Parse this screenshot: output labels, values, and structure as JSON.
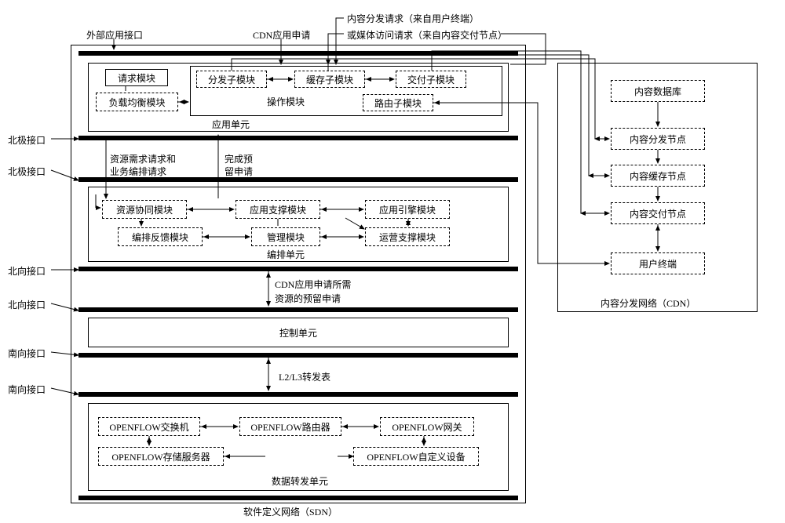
{
  "top_labels": {
    "external_interface": "外部应用接口",
    "cdn_app_request": "CDN应用申请",
    "content_dist_req": "内容分发请求（来自用户终端）",
    "media_access_req": "或媒体访问请求（来自内容交付节点）"
  },
  "side_labels": {
    "north_pole_1": "北极接口",
    "north_pole_2": "北极接口",
    "northbound_1": "北向接口",
    "northbound_2": "北向接口",
    "southbound_1": "南向接口",
    "southbound_2": "南向接口"
  },
  "app_unit": {
    "frame_title": "应用单元",
    "request_module": "请求模块",
    "load_balance": "负载均衡模块",
    "dispatch_sub": "分发子模块",
    "cache_sub": "缓存子模块",
    "deliver_sub": "交付子模块",
    "route_sub": "路由子模块",
    "operation_module": "操作模块"
  },
  "inter_labels": {
    "resource_demand": "资源需求请求和",
    "orchestration_req": "业务编排请求",
    "complete_reserve": "完成预",
    "complete_reserve2": "留申请",
    "cdn_reserve1": "CDN应用申请所需",
    "cdn_reserve2": "资源的预留申请",
    "l2l3": "L2/L3转发表"
  },
  "orch_unit": {
    "frame_title": "编排单元",
    "resource_coop": "资源协同模块",
    "orch_feedback": "编排反馈模块",
    "app_support": "应用支撑模块",
    "mgmt_module": "管理模块",
    "app_engine": "应用引擎模块",
    "ops_support": "运营支撑模块"
  },
  "control_unit": {
    "title": "控制单元"
  },
  "forward_unit": {
    "frame_title": "数据转发单元",
    "of_switch": "OPENFLOW交换机",
    "of_router": "OPENFLOW路由器",
    "of_gateway": "OPENFLOW网关",
    "of_storage": "OPENFLOW存储服务器",
    "of_custom": "OPENFLOW自定义设备"
  },
  "sdn_title": "软件定义网络（SDN）",
  "cdn": {
    "frame_title": "内容分发网络（CDN）",
    "content_db": "内容数据库",
    "dist_node": "内容分发节点",
    "cache_node": "内容缓存节点",
    "deliver_node": "内容交付节点",
    "user_terminal": "用户终端"
  }
}
